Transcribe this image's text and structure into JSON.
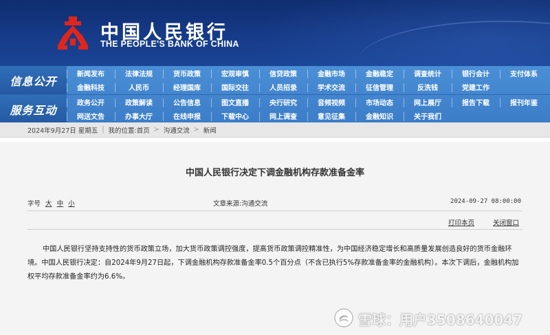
{
  "header": {
    "logo_cn": "中国人民银行",
    "logo_en": "THE PEOPLE'S BANK OF CHINA",
    "logo_color": "#e0261c",
    "background": "#163b88"
  },
  "nav": {
    "section1_title": "信息公开",
    "section1_row1": [
      "新闻发布",
      "法律法规",
      "货币政策",
      "宏观审慎",
      "信贷政策",
      "金融市场",
      "金融稳定",
      "调查统计",
      "银行会计",
      "支付体系"
    ],
    "section1_row2": [
      "金融科技",
      "人民币",
      "经理国库",
      "国际交往",
      "人员招录",
      "学术交流",
      "征信管理",
      "反洗钱",
      "党建工作"
    ],
    "section2_title": "服务互动",
    "section2_row1": [
      "政务公开",
      "政策解读",
      "公告信息",
      "图文直播",
      "央行研究",
      "音频视频",
      "市场动态",
      "网上展厅",
      "报告下载",
      "报刊年鉴"
    ],
    "section2_row2": [
      "网送文告",
      "办事大厅",
      "在线申报",
      "下载中心",
      "网上调查",
      "意见征集",
      "金融知识",
      "关于我们"
    ]
  },
  "breadcrumb": {
    "date": "2024年9月27日 星期五",
    "location_label": "我的位置:",
    "home": "首页",
    "section": "沟通交流",
    "page": "新闻"
  },
  "article": {
    "title": "中国人民银行决定下调金融机构存款准备金率",
    "font_size_label": "字号",
    "font_large": "大",
    "font_medium": "中",
    "font_small": "小",
    "source": "文章来源:沟通交流",
    "datetime": "2024-09-27 08:00:00",
    "print_label": "打印本页",
    "close_label": "关闭窗口",
    "body": "中国人民银行坚持支持性的货币政策立场，加大货币政策调控强度，提高货币政策调控精准性，为中国经济稳定增长和高质量发展创造良好的货币金融环境。中国人民银行决定：自2024年9月27日起，下调金融机构存款准备金率0.5个百分点（不含已执行5%存款准备金率的金融机构）。本次下调后，金融机构加权平均存款准备金率约为6.6%。"
  },
  "watermark": {
    "text": "雪球：用户3508640047"
  }
}
